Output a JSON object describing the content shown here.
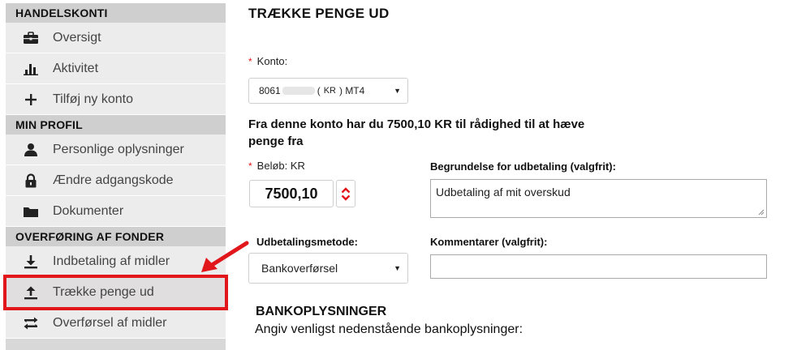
{
  "sidebar": {
    "sections": [
      {
        "heading": "HANDELSKONTI",
        "items": [
          {
            "label": "Oversigt",
            "icon": "briefcase-icon"
          },
          {
            "label": "Aktivitet",
            "icon": "bar-chart-icon"
          },
          {
            "label": "Tilføj ny konto",
            "icon": "plus-icon"
          }
        ]
      },
      {
        "heading": "MIN PROFIL",
        "items": [
          {
            "label": "Personlige oplysninger",
            "icon": "user-icon"
          },
          {
            "label": "Ændre adgangskode",
            "icon": "lock-icon"
          },
          {
            "label": "Dokumenter",
            "icon": "folder-icon"
          }
        ]
      },
      {
        "heading": "OVERFØRING AF FONDER",
        "items": [
          {
            "label": "Indbetaling af midler",
            "icon": "download-icon"
          },
          {
            "label": "Trække penge ud",
            "icon": "upload-icon",
            "active": true
          },
          {
            "label": "Overførsel af midler",
            "icon": "transfer-icon"
          }
        ]
      }
    ]
  },
  "main": {
    "title": "TRÆKKE PENGE UD",
    "account": {
      "required_mark": "*",
      "label": "Konto:",
      "value_prefix": "8061",
      "value_currency": "KR",
      "value_suffix": ") MT4"
    },
    "available_text": "Fra denne konto har du 7500,10 KR til rådighed til at hæve penge fra",
    "amount": {
      "required_mark": "*",
      "label": "Beløb: KR",
      "value": "7500,10"
    },
    "reason": {
      "label": "Begrundelse for udbetaling (valgfrit):",
      "value": "Udbetaling af mit overskud"
    },
    "method": {
      "label": "Udbetalingsmetode:",
      "value": "Bankoverførsel"
    },
    "comments": {
      "label": "Kommentarer (valgfrit):",
      "value": ""
    },
    "bank": {
      "title": "BANKOPLYSNINGER",
      "subtitle": "Angiv venligst nedenstående bankoplysninger:"
    }
  },
  "colors": {
    "highlight": "#e2171b",
    "required": "#e2171b",
    "sidebar_bg": "#ebebeb",
    "section_bg": "#cfcfcf"
  }
}
